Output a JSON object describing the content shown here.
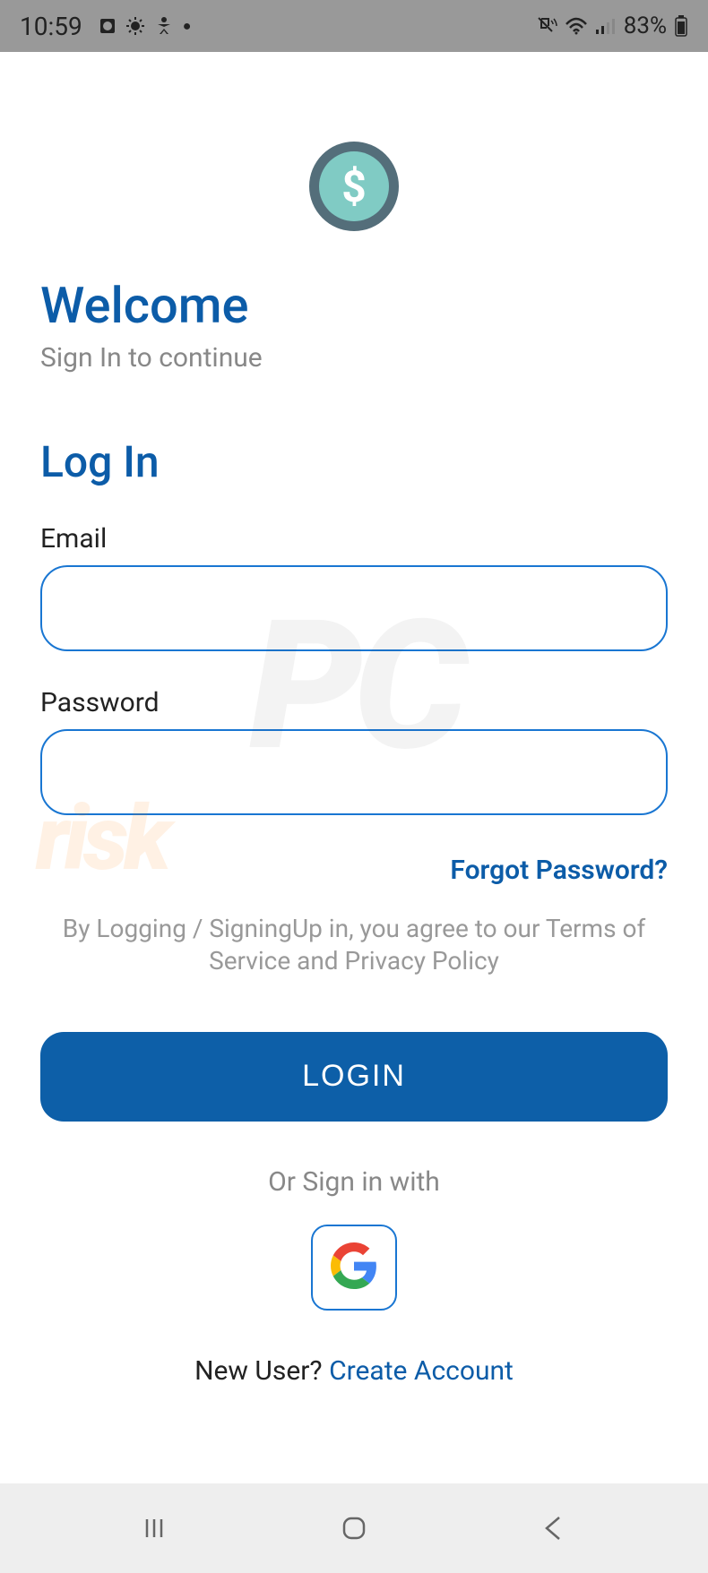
{
  "status_bar": {
    "time": "10:59",
    "battery": "83%"
  },
  "header": {
    "title": "Welcome",
    "subtitle": "Sign In to continue"
  },
  "form": {
    "heading": "Log In",
    "email_label": "Email",
    "email_value": "",
    "password_label": "Password",
    "password_value": "",
    "forgot_password": "Forgot Password?",
    "terms": "By Logging / SigningUp in, you agree to our Terms of Service and Privacy Policy",
    "login_button": "LOGIN",
    "or_text": "Or Sign in with",
    "new_user_text": "New User? ",
    "create_account": "Create Account"
  }
}
